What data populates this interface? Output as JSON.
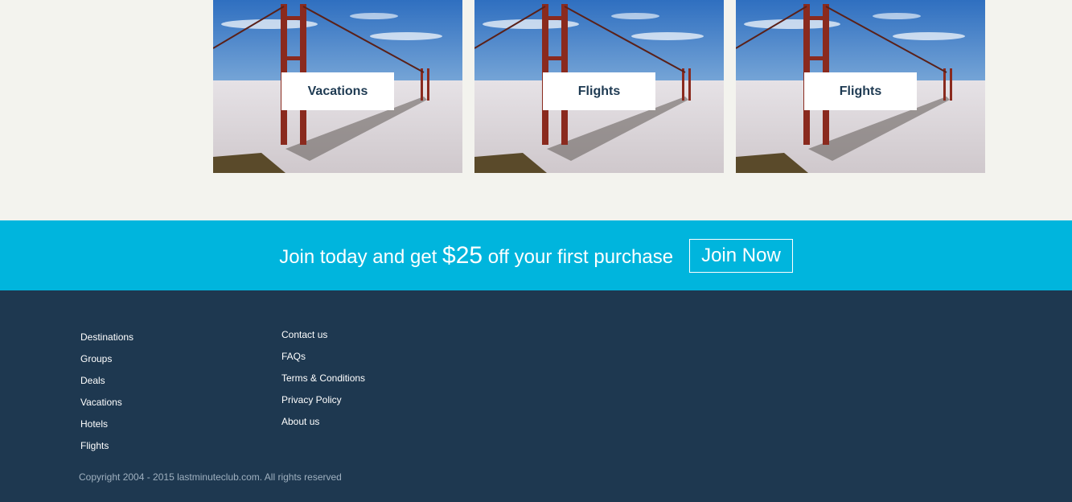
{
  "cards": [
    {
      "label": "Vacations"
    },
    {
      "label": "Flights"
    },
    {
      "label": "Flights"
    }
  ],
  "promo": {
    "text_before": "Join today and get ",
    "amount": "$25",
    "text_after": " off your first purchase",
    "button_label": "Join Now"
  },
  "footer": {
    "col1": [
      "Destinations",
      "Groups",
      "Deals",
      "Vacations",
      "Hotels",
      "Flights"
    ],
    "col2": [
      "Contact us",
      "FAQs",
      "Terms & Conditions",
      "Privacy Policy",
      "About us"
    ],
    "copyright": "Copyright 2004 - 2015 lastminuteclub.com. All rights reserved"
  },
  "colors": {
    "background": "#f3f3ee",
    "promo_bar": "#00b5dd",
    "footer": "#1e3850",
    "label_text": "#1e3a52"
  }
}
